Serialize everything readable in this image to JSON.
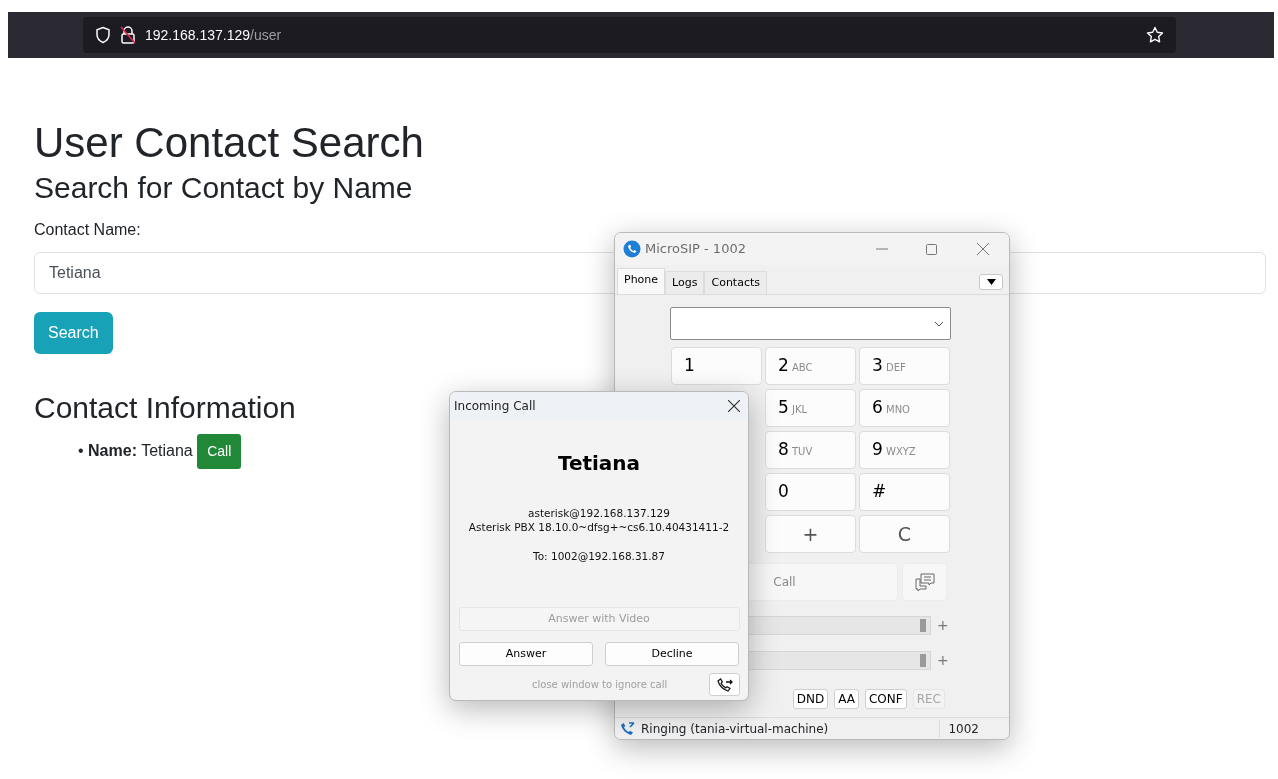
{
  "browser": {
    "url_host": "192.168.137.129",
    "url_path": "/user"
  },
  "page": {
    "title": "User Contact Search",
    "subtitle": "Search for Contact by Name",
    "field_label": "Contact Name:",
    "field_value": "Tetiana",
    "search_button": "Search",
    "section_title": "Contact Information",
    "contact": {
      "bullet": "•",
      "label": "Name:",
      "value": "Tetiana",
      "call_button": "Call"
    }
  },
  "microsip": {
    "title": "MicroSIP - 1002",
    "tabs": [
      {
        "label": "Phone",
        "selected": true
      },
      {
        "label": "Logs",
        "selected": false
      },
      {
        "label": "Contacts",
        "selected": false
      }
    ],
    "keypad": [
      [
        {
          "digit": "1"
        },
        {
          "digit": "2",
          "letters": "ABC"
        },
        {
          "digit": "3",
          "letters": "DEF"
        }
      ],
      [
        {
          "digit": "5",
          "letters": "JKL"
        },
        {
          "digit": "6",
          "letters": "MNO"
        }
      ],
      [
        {
          "digit": "8",
          "letters": "TUV"
        },
        {
          "digit": "9",
          "letters": "WXYZ"
        }
      ],
      [
        {
          "digit": "0"
        },
        {
          "digit": "#"
        }
      ],
      [
        {
          "digit": "+"
        },
        {
          "digit": "C"
        }
      ]
    ],
    "call_button": {
      "label": "Call",
      "disabled": true
    },
    "sliders": [
      {
        "level": 1,
        "plus": "+"
      },
      {
        "level": 1,
        "plus": "+"
      }
    ],
    "toggles": [
      {
        "label": "DND",
        "disabled": false
      },
      {
        "label": "AA",
        "disabled": false
      },
      {
        "label": "CONF",
        "disabled": false
      },
      {
        "label": "REC",
        "disabled": true
      }
    ],
    "status": {
      "text": "Ringing (tania-virtual-machine)",
      "account": "1002"
    }
  },
  "incoming_call": {
    "title": "Incoming Call",
    "caller": "Tetiana",
    "lines": [
      "asterisk@192.168.137.129",
      "Asterisk PBX 18.10.0~dfsg+~cs6.10.40431411-2"
    ],
    "to": "To: 1002@192.168.31.87",
    "video_button": {
      "label": "Answer with Video",
      "disabled": true
    },
    "buttons": [
      "Answer",
      "Decline"
    ],
    "hint": "close window to ignore call"
  }
}
